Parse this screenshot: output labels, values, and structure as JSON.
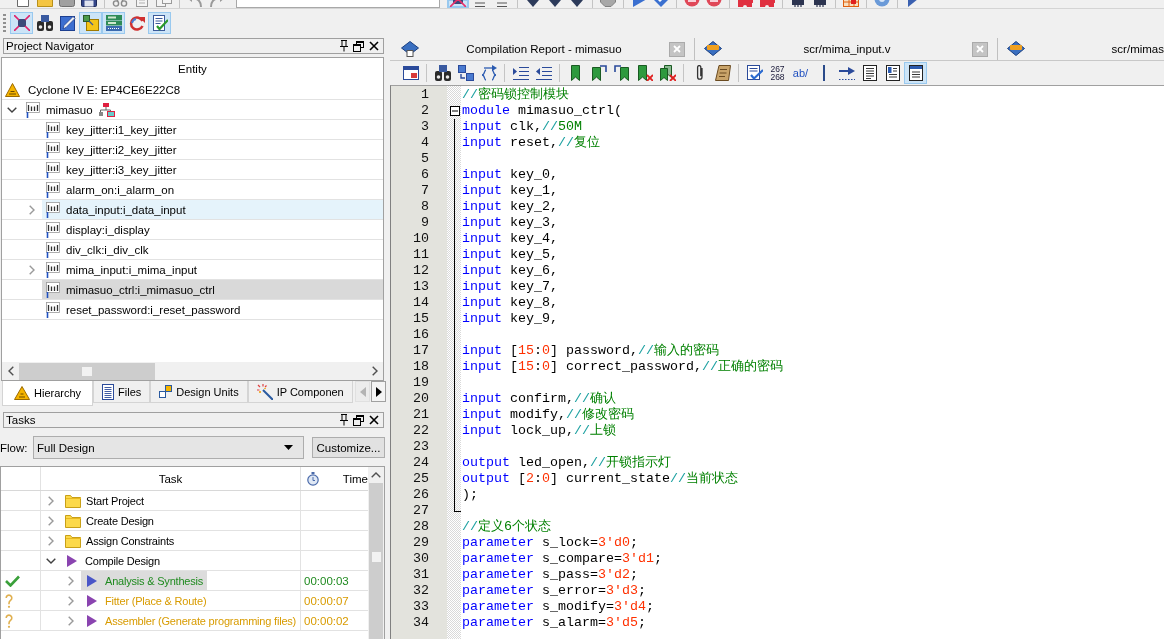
{
  "toolbar_top": {
    "left_groups": [
      [
        {
          "on": false
        },
        {
          "on": false
        },
        {
          "on": false
        },
        {
          "on": false
        }
      ],
      [
        {
          "on": false
        },
        {
          "on": false
        },
        {
          "on": false
        }
      ],
      [
        {
          "on": false
        },
        {
          "on": false
        }
      ]
    ],
    "right_groups": [
      [
        {
          "on": true
        },
        {
          "on": false
        },
        {
          "on": false
        }
      ],
      [
        {
          "on": false
        },
        {
          "on": false
        },
        {
          "on": false
        }
      ],
      [
        {
          "on": false
        }
      ],
      [
        {
          "on": false
        },
        {
          "on": false
        }
      ],
      [
        {
          "on": false
        },
        {
          "on": false
        }
      ],
      [
        {
          "on": false
        },
        {
          "on": false
        }
      ],
      [
        {
          "on": false
        },
        {
          "on": false
        }
      ],
      [
        {
          "on": false
        }
      ],
      [
        {
          "on": false
        }
      ],
      [
        {
          "on": false
        }
      ]
    ]
  },
  "toolbar_tools": {
    "buttons": [
      {
        "on": true
      },
      {
        "on": false
      },
      {
        "on": false
      },
      {
        "on": true
      },
      {
        "on": true
      },
      {
        "on": false
      },
      {
        "on": true
      }
    ]
  },
  "project_navigator": {
    "title": "Project Navigator",
    "column": "Entity",
    "device": "Cyclone IV E: EP4CE6E22C8",
    "items": [
      {
        "label": "mimasuo",
        "has_children": true,
        "expanded": true,
        "selected": false,
        "hovered": false,
        "top_level": true,
        "children": [
          {
            "label": "key_jitter:i1_key_jitter",
            "has_children": false,
            "expanded": false,
            "selected": false,
            "hovered": false,
            "top_level": false
          },
          {
            "label": "key_jitter:i2_key_jitter",
            "has_children": false,
            "expanded": false,
            "selected": false,
            "hovered": false,
            "top_level": false
          },
          {
            "label": "key_jitter:i3_key_jitter",
            "has_children": false,
            "expanded": false,
            "selected": false,
            "hovered": false,
            "top_level": false
          },
          {
            "label": "alarm_on:i_alarm_on",
            "has_children": false,
            "expanded": false,
            "selected": false,
            "hovered": false,
            "top_level": false
          },
          {
            "label": "data_input:i_data_input",
            "has_children": true,
            "expanded": false,
            "selected": false,
            "hovered": true,
            "top_level": false
          },
          {
            "label": "display:i_display",
            "has_children": false,
            "expanded": false,
            "selected": false,
            "hovered": false,
            "top_level": false
          },
          {
            "label": "div_clk:i_div_clk",
            "has_children": false,
            "expanded": false,
            "selected": false,
            "hovered": false,
            "top_level": false
          },
          {
            "label": "mima_input:i_mima_input",
            "has_children": true,
            "expanded": false,
            "selected": false,
            "hovered": false,
            "top_level": false
          },
          {
            "label": "mimasuo_ctrl:i_mimasuo_ctrl",
            "has_children": false,
            "expanded": false,
            "selected": true,
            "hovered": false,
            "top_level": false
          },
          {
            "label": "reset_password:i_reset_password",
            "has_children": false,
            "expanded": false,
            "selected": false,
            "hovered": false,
            "top_level": false
          }
        ]
      }
    ],
    "tabs": [
      {
        "label": "Hierarchy",
        "selected": true
      },
      {
        "label": "Files",
        "selected": false
      },
      {
        "label": "Design Units",
        "selected": false
      },
      {
        "label": "IP Componen",
        "selected": false
      }
    ],
    "tab_scroll_buttons": [
      {
        "disabled": true
      },
      {
        "disabled": false
      }
    ]
  },
  "tasks": {
    "title": "Tasks",
    "flow_label": "Flow:",
    "flow": "Full Design",
    "customize_button": "Customize...",
    "columns": [
      "Task",
      "Time"
    ],
    "items": [
      {
        "label": "Start Project",
        "kind": "folder",
        "expanded": false,
        "selected": false,
        "completed": false,
        "outdated": false
      },
      {
        "label": "Create Design",
        "kind": "folder",
        "expanded": false,
        "selected": false,
        "completed": false,
        "outdated": false
      },
      {
        "label": "Assign Constraints",
        "kind": "folder",
        "expanded": false,
        "selected": false,
        "completed": false,
        "outdated": false
      },
      {
        "label": "Compile Design",
        "kind": "flow",
        "expanded": true,
        "selected": false,
        "completed": false,
        "outdated": false,
        "children": [
          {
            "label": "Analysis & Synthesis",
            "kind": "flow",
            "expanded": false,
            "selected": true,
            "completed": true,
            "outdated": false,
            "time": "00:00:03"
          },
          {
            "label": "Fitter (Place & Route)",
            "kind": "flow",
            "expanded": false,
            "selected": false,
            "completed": false,
            "outdated": true,
            "time": "00:00:07"
          },
          {
            "label": "Assembler (Generate programming files)",
            "kind": "flow",
            "expanded": false,
            "selected": false,
            "completed": false,
            "outdated": true,
            "time": "00:00:02"
          }
        ]
      }
    ]
  },
  "editor": {
    "tabs": [
      {
        "label": "Compilation Report - mimasuo",
        "kind": "report",
        "selected": false,
        "closable": true
      },
      {
        "label": "scr/mima_input.v",
        "kind": "file",
        "selected": false,
        "closable": true
      },
      {
        "label": "scr/mimas",
        "kind": "file",
        "selected": false,
        "closable": false
      }
    ],
    "toolbar_groups": [
      [
        {
          "on": false
        }
      ],
      [
        {
          "on": false
        },
        {
          "on": false
        },
        {
          "on": false
        }
      ],
      [
        {
          "on": false
        },
        {
          "on": false
        }
      ],
      [
        {
          "on": false
        },
        {
          "on": false
        },
        {
          "on": false
        },
        {
          "on": false
        },
        {
          "on": false
        }
      ],
      [
        {
          "on": false
        },
        {
          "on": false
        }
      ],
      [
        {
          "on": false
        },
        {
          "on": false,
          "label_lines": [
            "267",
            "268"
          ]
        },
        {
          "on": false,
          "label": "ab/"
        },
        {
          "on": false
        },
        {
          "on": false
        },
        {
          "on": false
        },
        {
          "on": false
        },
        {
          "on": true
        }
      ]
    ],
    "lines": [
      {
        "number": "1",
        "segments": [
          {
            "kind": "comment_mark",
            "text": "//"
          },
          {
            "kind": "comment",
            "text": "密码锁控制模块"
          }
        ]
      },
      {
        "number": "2",
        "segments": [
          {
            "kind": "keyword",
            "text": "module"
          },
          {
            "kind": "plain",
            "text": " mimasuo_ctrl("
          }
        ],
        "expanded": true,
        "children": [
          {
            "number": "3",
            "segments": [
              {
                "kind": "keyword",
                "text": "input"
              },
              {
                "kind": "plain",
                "text": " clk,"
              },
              {
                "kind": "comment_mark",
                "text": "//"
              },
              {
                "kind": "comment",
                "text": "50M"
              }
            ]
          },
          {
            "number": "4",
            "segments": [
              {
                "kind": "keyword",
                "text": "input"
              },
              {
                "kind": "plain",
                "text": " reset,"
              },
              {
                "kind": "comment_mark",
                "text": "//"
              },
              {
                "kind": "comment",
                "text": "复位"
              }
            ]
          },
          {
            "number": "5"
          },
          {
            "number": "6",
            "segments": [
              {
                "kind": "keyword",
                "text": "input"
              },
              {
                "kind": "plain",
                "text": " key_0,"
              }
            ]
          },
          {
            "number": "7",
            "segments": [
              {
                "kind": "keyword",
                "text": "input"
              },
              {
                "kind": "plain",
                "text": " key_1,"
              }
            ]
          },
          {
            "number": "8",
            "segments": [
              {
                "kind": "keyword",
                "text": "input"
              },
              {
                "kind": "plain",
                "text": " key_2,"
              }
            ]
          },
          {
            "number": "9",
            "segments": [
              {
                "kind": "keyword",
                "text": "input"
              },
              {
                "kind": "plain",
                "text": " key_3,"
              }
            ]
          },
          {
            "number": "10",
            "segments": [
              {
                "kind": "keyword",
                "text": "input"
              },
              {
                "kind": "plain",
                "text": " key_4,"
              }
            ]
          },
          {
            "number": "11",
            "segments": [
              {
                "kind": "keyword",
                "text": "input"
              },
              {
                "kind": "plain",
                "text": " key_5,"
              }
            ]
          },
          {
            "number": "12",
            "segments": [
              {
                "kind": "keyword",
                "text": "input"
              },
              {
                "kind": "plain",
                "text": " key_6,"
              }
            ]
          },
          {
            "number": "13",
            "segments": [
              {
                "kind": "keyword",
                "text": "input"
              },
              {
                "kind": "plain",
                "text": " key_7,"
              }
            ]
          },
          {
            "number": "14",
            "segments": [
              {
                "kind": "keyword",
                "text": "input"
              },
              {
                "kind": "plain",
                "text": " key_8,"
              }
            ]
          },
          {
            "number": "15",
            "segments": [
              {
                "kind": "keyword",
                "text": "input"
              },
              {
                "kind": "plain",
                "text": " key_9,"
              }
            ]
          },
          {
            "number": "16"
          },
          {
            "number": "17",
            "segments": [
              {
                "kind": "keyword",
                "text": "input"
              },
              {
                "kind": "plain",
                "text": " ["
              },
              {
                "kind": "number",
                "text": "15"
              },
              {
                "kind": "plain",
                "text": ":"
              },
              {
                "kind": "number",
                "text": "0"
              },
              {
                "kind": "plain",
                "text": "] password,"
              },
              {
                "kind": "comment_mark",
                "text": "//"
              },
              {
                "kind": "comment",
                "text": "输入的密码"
              }
            ]
          },
          {
            "number": "18",
            "segments": [
              {
                "kind": "keyword",
                "text": "input"
              },
              {
                "kind": "plain",
                "text": " ["
              },
              {
                "kind": "number",
                "text": "15"
              },
              {
                "kind": "plain",
                "text": ":"
              },
              {
                "kind": "number",
                "text": "0"
              },
              {
                "kind": "plain",
                "text": "] correct_password,"
              },
              {
                "kind": "comment_mark",
                "text": "//"
              },
              {
                "kind": "comment",
                "text": "正确的密码"
              }
            ]
          },
          {
            "number": "19"
          },
          {
            "number": "20",
            "segments": [
              {
                "kind": "keyword",
                "text": "input"
              },
              {
                "kind": "plain",
                "text": " confirm,"
              },
              {
                "kind": "comment_mark",
                "text": "//"
              },
              {
                "kind": "comment",
                "text": "确认"
              }
            ]
          },
          {
            "number": "21",
            "segments": [
              {
                "kind": "keyword",
                "text": "input"
              },
              {
                "kind": "plain",
                "text": " modify,"
              },
              {
                "kind": "comment_mark",
                "text": "//"
              },
              {
                "kind": "comment",
                "text": "修改密码"
              }
            ]
          },
          {
            "number": "22",
            "segments": [
              {
                "kind": "keyword",
                "text": "input"
              },
              {
                "kind": "plain",
                "text": " lock_up,"
              },
              {
                "kind": "comment_mark",
                "text": "//"
              },
              {
                "kind": "comment",
                "text": "上锁"
              }
            ]
          },
          {
            "number": "23"
          },
          {
            "number": "24",
            "segments": [
              {
                "kind": "keyword",
                "text": "output"
              },
              {
                "kind": "plain",
                "text": " led_open,"
              },
              {
                "kind": "comment_mark",
                "text": "//"
              },
              {
                "kind": "comment",
                "text": "开锁指示灯"
              }
            ]
          },
          {
            "number": "25",
            "segments": [
              {
                "kind": "keyword",
                "text": "output"
              },
              {
                "kind": "plain",
                "text": " ["
              },
              {
                "kind": "number",
                "text": "2"
              },
              {
                "kind": "plain",
                "text": ":"
              },
              {
                "kind": "number",
                "text": "0"
              },
              {
                "kind": "plain",
                "text": "] current_state"
              },
              {
                "kind": "comment_mark",
                "text": "//"
              },
              {
                "kind": "comment",
                "text": "当前状态"
              }
            ]
          },
          {
            "number": "26",
            "segments": [
              {
                "kind": "plain",
                "text": ");"
              }
            ]
          },
          {
            "number": "27"
          }
        ]
      },
      {
        "number": "28",
        "segments": [
          {
            "kind": "comment_mark",
            "text": "//"
          },
          {
            "kind": "comment",
            "text": "定义6个状态"
          }
        ]
      },
      {
        "number": "29",
        "segments": [
          {
            "kind": "keyword",
            "text": "parameter"
          },
          {
            "kind": "plain",
            "text": " s_lock="
          },
          {
            "kind": "number",
            "text": "3'd0"
          },
          {
            "kind": "plain",
            "text": ";"
          }
        ]
      },
      {
        "number": "30",
        "segments": [
          {
            "kind": "keyword",
            "text": "parameter"
          },
          {
            "kind": "plain",
            "text": " s_compare="
          },
          {
            "kind": "number",
            "text": "3'd1"
          },
          {
            "kind": "plain",
            "text": ";"
          }
        ]
      },
      {
        "number": "31",
        "segments": [
          {
            "kind": "keyword",
            "text": "parameter"
          },
          {
            "kind": "plain",
            "text": " s_pass="
          },
          {
            "kind": "number",
            "text": "3'd2"
          },
          {
            "kind": "plain",
            "text": ";"
          }
        ]
      },
      {
        "number": "32",
        "segments": [
          {
            "kind": "keyword",
            "text": "parameter"
          },
          {
            "kind": "plain",
            "text": " s_error="
          },
          {
            "kind": "number",
            "text": "3'd3"
          },
          {
            "kind": "plain",
            "text": ";"
          }
        ]
      },
      {
        "number": "33",
        "segments": [
          {
            "kind": "keyword",
            "text": "parameter"
          },
          {
            "kind": "plain",
            "text": " s_modify="
          },
          {
            "kind": "number",
            "text": "3'd4"
          },
          {
            "kind": "plain",
            "text": ";"
          }
        ]
      },
      {
        "number": "34",
        "segments": [
          {
            "kind": "keyword",
            "text": "parameter"
          },
          {
            "kind": "plain",
            "text": " s_alarm="
          },
          {
            "kind": "number",
            "text": "3'd5"
          },
          {
            "kind": "plain",
            "text": ";"
          }
        ]
      }
    ]
  }
}
